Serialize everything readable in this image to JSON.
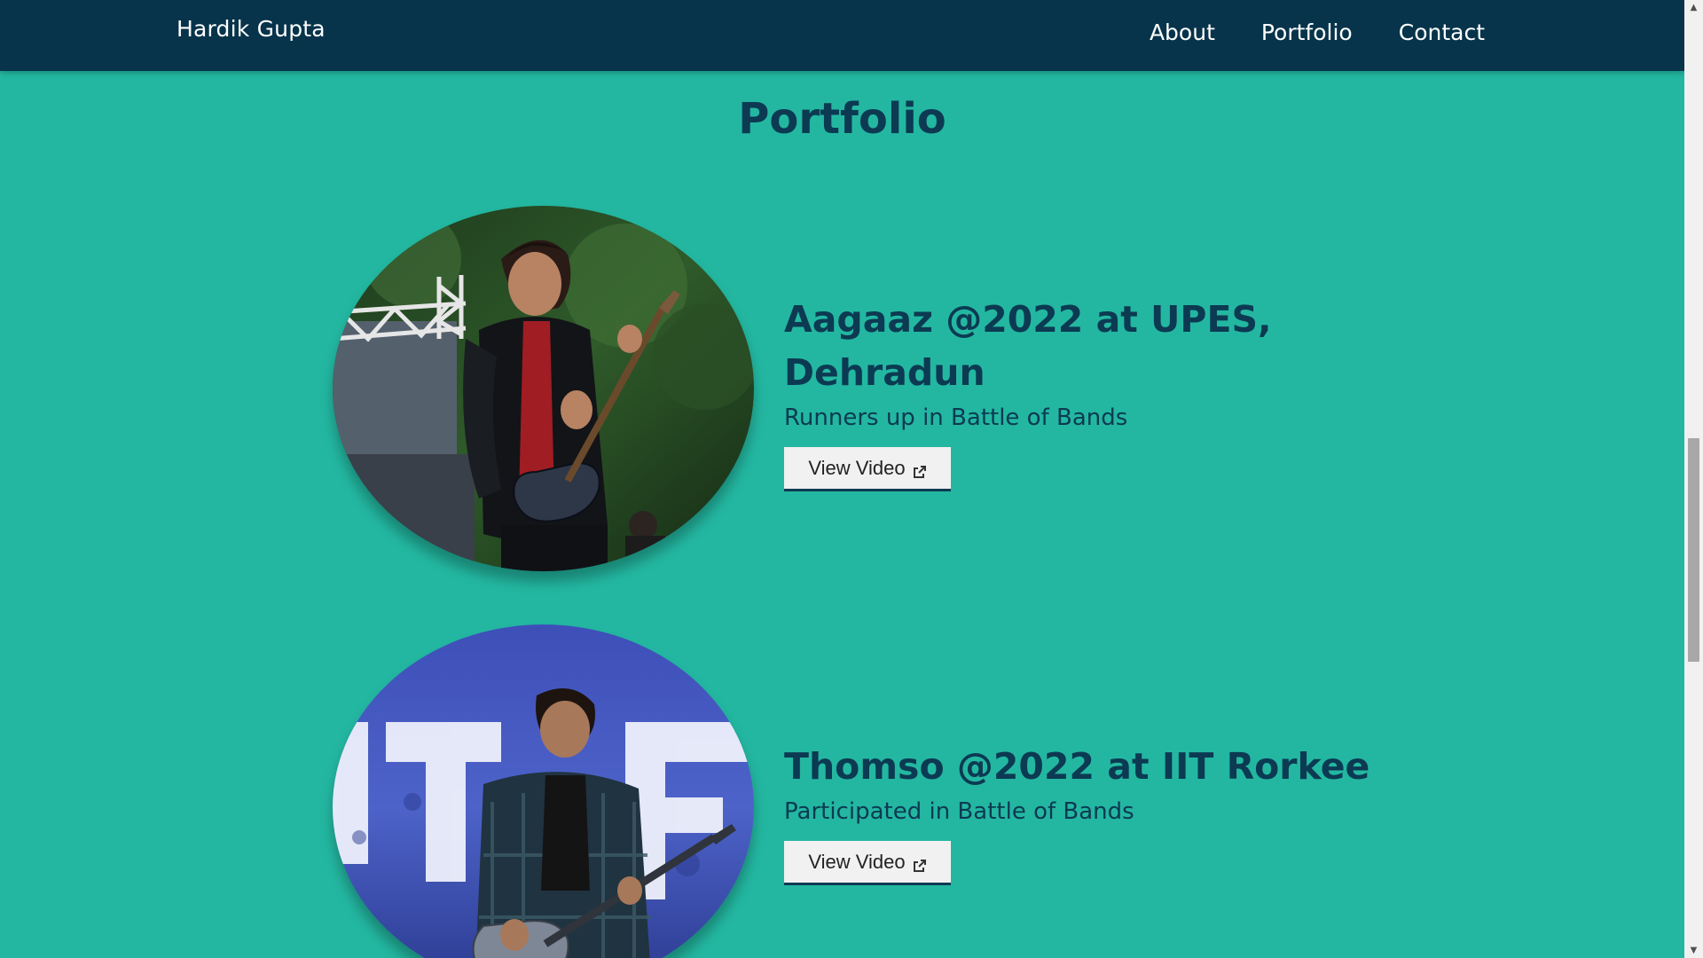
{
  "nav": {
    "brand": "Hardik Gupta",
    "links": [
      "About",
      "Portfolio",
      "Contact"
    ]
  },
  "section": {
    "title": "Portfolio"
  },
  "items": [
    {
      "title": "Aagaaz @2022 at UPES, Dehradun",
      "subtitle": "Runners up in Battle of Bands",
      "button": "View Video",
      "icon": "external-link-icon"
    },
    {
      "title": "Thomso @2022 at IIT Rorkee",
      "subtitle": "Participated in Battle of Bands",
      "button": "View Video",
      "icon": "external-link-icon"
    }
  ],
  "colors": {
    "background": "#23b7a1",
    "navbar": "#07344a",
    "heading": "#0c3a52",
    "button": "#f1f1f1"
  }
}
